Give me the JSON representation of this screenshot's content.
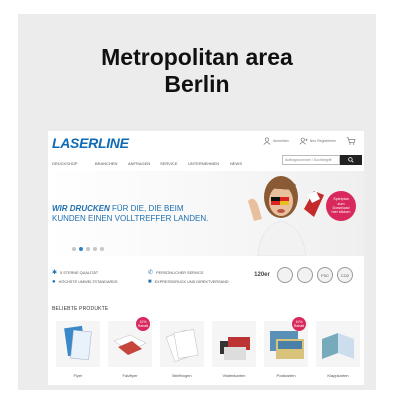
{
  "heading": {
    "line1": "Metropolitan area",
    "line2": "Berlin"
  },
  "site": {
    "logo": "LASERLINE",
    "header_icons": [
      {
        "label": "Anmelden",
        "icon": "user-icon"
      },
      {
        "label": "Neu Registrieren",
        "icon": "user-plus-icon"
      },
      {
        "label": "",
        "icon": "cart-icon"
      }
    ],
    "nav": [
      "DRUCKSHOP",
      "BRANCHEN",
      "ANFRAGEN",
      "SERVICE",
      "UNTERNEHMEN",
      "NEWS"
    ],
    "search": {
      "placeholder": "Auftragsnummer / Suchbegriff",
      "icon": "search-icon"
    },
    "hero": {
      "line1_bold": "WIR DRUCKEN",
      "line1_rest": " FÜR DIE, DIE BEIM",
      "line2": "KUNDEN EINEN VOLLTREFFER LANDEN.",
      "badge": [
        "Spielplan",
        "zum",
        "Download",
        "hier klicken"
      ],
      "slides": 5,
      "active_slide": 1
    },
    "features": [
      {
        "icon": "star-icon",
        "text": "5 STERNE QUALITÄT"
      },
      {
        "icon": "phone-icon",
        "text": "PERSÖNLICHER SERVICE"
      },
      {
        "icon": "leaf-icon",
        "text": "HÖCHSTE UMWELTSTANDARDS"
      },
      {
        "icon": "truck-icon",
        "text": "EXPRESSDRUCK UND DIREKTVERSAND"
      }
    ],
    "certs": [
      "120er",
      "",
      "",
      "FSC",
      "CO2"
    ],
    "products_title": "BELIEBTE PRODUKTE",
    "products": [
      {
        "label": "Flyer",
        "sale": ""
      },
      {
        "label": "Falzflyer",
        "sale": "10%"
      },
      {
        "label": "Briefbogen",
        "sale": ""
      },
      {
        "label": "Visitenkarten",
        "sale": ""
      },
      {
        "label": "Postkarten",
        "sale": "10%"
      },
      {
        "label": "Klappkarten",
        "sale": ""
      }
    ],
    "sale_text": "Rabatt",
    "colors": {
      "brand": "#0f6bb5",
      "accent": "#d8285c"
    }
  }
}
